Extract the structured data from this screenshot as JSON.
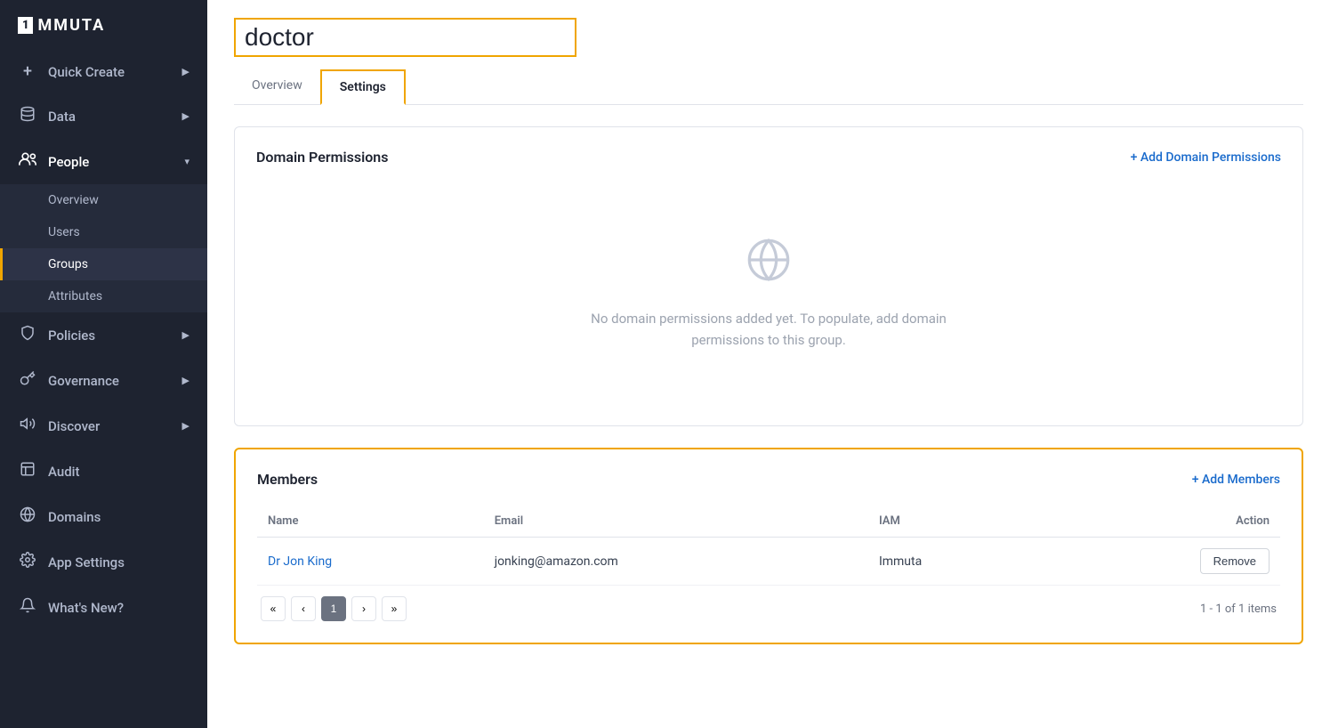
{
  "app": {
    "logo_box": "1",
    "logo_text": "MMUTA"
  },
  "sidebar": {
    "items": [
      {
        "id": "quick-create",
        "label": "Quick Create",
        "icon": "+",
        "has_chevron": true
      },
      {
        "id": "data",
        "label": "Data",
        "icon": "🗄",
        "has_chevron": true
      },
      {
        "id": "people",
        "label": "People",
        "icon": "👥",
        "has_chevron": true,
        "active": true
      },
      {
        "id": "policies",
        "label": "Policies",
        "icon": "🛡",
        "has_chevron": true
      },
      {
        "id": "governance",
        "label": "Governance",
        "icon": "🔑",
        "has_chevron": true
      },
      {
        "id": "discover",
        "label": "Discover",
        "icon": "📢",
        "has_chevron": true
      },
      {
        "id": "audit",
        "label": "Audit",
        "icon": "📋",
        "has_chevron": false
      },
      {
        "id": "domains",
        "label": "Domains",
        "icon": "🌐",
        "has_chevron": false
      },
      {
        "id": "app-settings",
        "label": "App Settings",
        "icon": "⚙",
        "has_chevron": false
      },
      {
        "id": "whats-new",
        "label": "What's New?",
        "icon": "🔔",
        "has_chevron": false
      }
    ],
    "people_sub": [
      {
        "id": "overview",
        "label": "Overview",
        "active": false
      },
      {
        "id": "users",
        "label": "Users",
        "active": false
      },
      {
        "id": "groups",
        "label": "Groups",
        "active": true
      },
      {
        "id": "attributes",
        "label": "Attributes",
        "active": false
      }
    ]
  },
  "header": {
    "title": "doctor",
    "tabs": [
      {
        "id": "overview",
        "label": "Overview",
        "active": false
      },
      {
        "id": "settings",
        "label": "Settings",
        "active": true
      }
    ]
  },
  "domain_permissions": {
    "section_title": "Domain Permissions",
    "add_button": "+ Add Domain Permissions",
    "empty_message": "No domain permissions added yet. To populate, add domain",
    "empty_message2": "permissions to this group."
  },
  "members": {
    "section_title": "Members",
    "add_button": "+ Add Members",
    "columns": [
      {
        "id": "name",
        "label": "Name"
      },
      {
        "id": "email",
        "label": "Email"
      },
      {
        "id": "iam",
        "label": "IAM"
      },
      {
        "id": "action",
        "label": "Action"
      }
    ],
    "rows": [
      {
        "name": "Dr Jon King",
        "email": "jonking@amazon.com",
        "iam": "Immuta",
        "action": "Remove"
      }
    ],
    "pagination": {
      "page": "1",
      "info": "1 - 1 of 1 items"
    }
  }
}
